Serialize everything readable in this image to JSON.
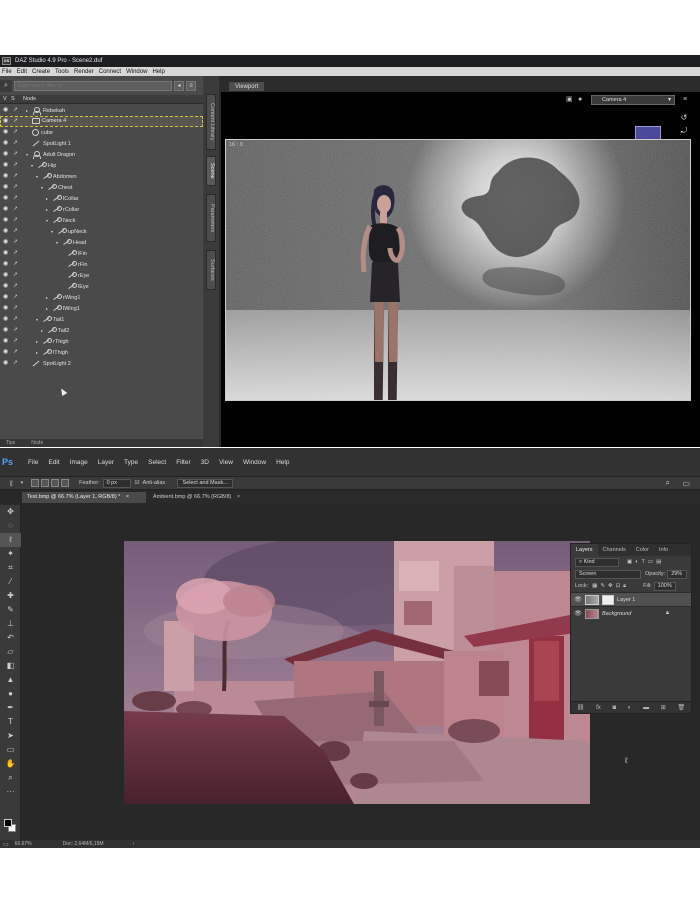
{
  "daz": {
    "title": "DAZ Studio 4.9 Pro - Scene2.duf",
    "logo": "DS",
    "menu": [
      "File",
      "Edit",
      "Create",
      "Tools",
      "Render",
      "Connect",
      "Window",
      "Help"
    ],
    "scene": {
      "search_placeholder": "Enter text to filter by...",
      "header_v": "V",
      "header_s": "S",
      "header_node": "Node",
      "nodes": [
        {
          "label": "Rebekah",
          "depth": 0,
          "twist": "▸",
          "icon": "fig"
        },
        {
          "label": "Camera 4",
          "depth": 0,
          "twist": "",
          "icon": "cam",
          "selected": true
        },
        {
          "label": "cube",
          "depth": 0,
          "twist": "",
          "icon": "cube"
        },
        {
          "label": "SpotLight 1",
          "depth": 0,
          "twist": "",
          "icon": "light"
        },
        {
          "label": "Adult Dragon",
          "depth": 0,
          "twist": "▾",
          "icon": "fig"
        },
        {
          "label": "Hip",
          "depth": 1,
          "twist": "▾",
          "icon": "bone"
        },
        {
          "label": "Abdomen",
          "depth": 2,
          "twist": "▾",
          "icon": "bone"
        },
        {
          "label": "Chest",
          "depth": 3,
          "twist": "▾",
          "icon": "bone"
        },
        {
          "label": "lCollar",
          "depth": 4,
          "twist": "▸",
          "icon": "bone"
        },
        {
          "label": "rCollar",
          "depth": 4,
          "twist": "▸",
          "icon": "bone"
        },
        {
          "label": "Neck",
          "depth": 4,
          "twist": "▾",
          "icon": "bone"
        },
        {
          "label": "upNeck",
          "depth": 5,
          "twist": "▾",
          "icon": "bone"
        },
        {
          "label": "Head",
          "depth": 6,
          "twist": "▾",
          "icon": "bone"
        },
        {
          "label": "lFin",
          "depth": 7,
          "twist": "",
          "icon": "bone"
        },
        {
          "label": "rFin",
          "depth": 7,
          "twist": "",
          "icon": "bone"
        },
        {
          "label": "rEye",
          "depth": 7,
          "twist": "",
          "icon": "bone"
        },
        {
          "label": "lEye",
          "depth": 7,
          "twist": "",
          "icon": "bone"
        },
        {
          "label": "rWing1",
          "depth": 4,
          "twist": "▸",
          "icon": "bone"
        },
        {
          "label": "lWing1",
          "depth": 4,
          "twist": "▸",
          "icon": "bone"
        },
        {
          "label": "Tail1",
          "depth": 2,
          "twist": "▾",
          "icon": "bone"
        },
        {
          "label": "Tail2",
          "depth": 3,
          "twist": "▸",
          "icon": "bone"
        },
        {
          "label": "rThigh",
          "depth": 2,
          "twist": "▸",
          "icon": "bone"
        },
        {
          "label": "lThigh",
          "depth": 2,
          "twist": "▸",
          "icon": "bone"
        },
        {
          "label": "SpotLight 2",
          "depth": 0,
          "twist": "",
          "icon": "light"
        }
      ],
      "bottom_tabs": [
        "Tips",
        "Node"
      ]
    },
    "side_tabs": [
      "Content Library",
      "Scene",
      "Parameters",
      "Surfaces"
    ],
    "viewport": {
      "tab_label": "Viewport",
      "camera": "Camera 4",
      "aspect": "16 : 9"
    }
  },
  "ps": {
    "logo": "Ps",
    "menu": [
      "File",
      "Edit",
      "Image",
      "Layer",
      "Type",
      "Select",
      "Filter",
      "3D",
      "View",
      "Window",
      "Help"
    ],
    "options": {
      "feather_label": "Feather:",
      "feather_value": "0 px",
      "antialias_label": "Anti-alias",
      "select_mask_label": "Select and Mask..."
    },
    "doc_tabs": [
      {
        "label": "Test.bmp @ 66.7% (Layer 1, RGB/8) *",
        "active": true
      },
      {
        "label": "Ambient.bmp @ 66.7% (RGB/8)",
        "active": false
      }
    ],
    "close_glyph": "×",
    "layers": {
      "tabs": [
        "Layers",
        "Channels",
        "Color",
        "Info"
      ],
      "filter": "Kind",
      "blend_mode": "Screen",
      "opacity_label": "Opacity:",
      "opacity_value": "29%",
      "lock_label": "Lock:",
      "fill_label": "Fill:",
      "fill_value": "100%",
      "items": [
        {
          "name": "Layer 1",
          "active": true
        },
        {
          "name": "Background",
          "active": false
        }
      ]
    },
    "status": {
      "zoom": "66.67%",
      "doc": "Doc: 2,64M/6,15M"
    }
  },
  "colors": {
    "ps_accent": "#4da4ff",
    "selection_outline": "#d4c23a"
  }
}
